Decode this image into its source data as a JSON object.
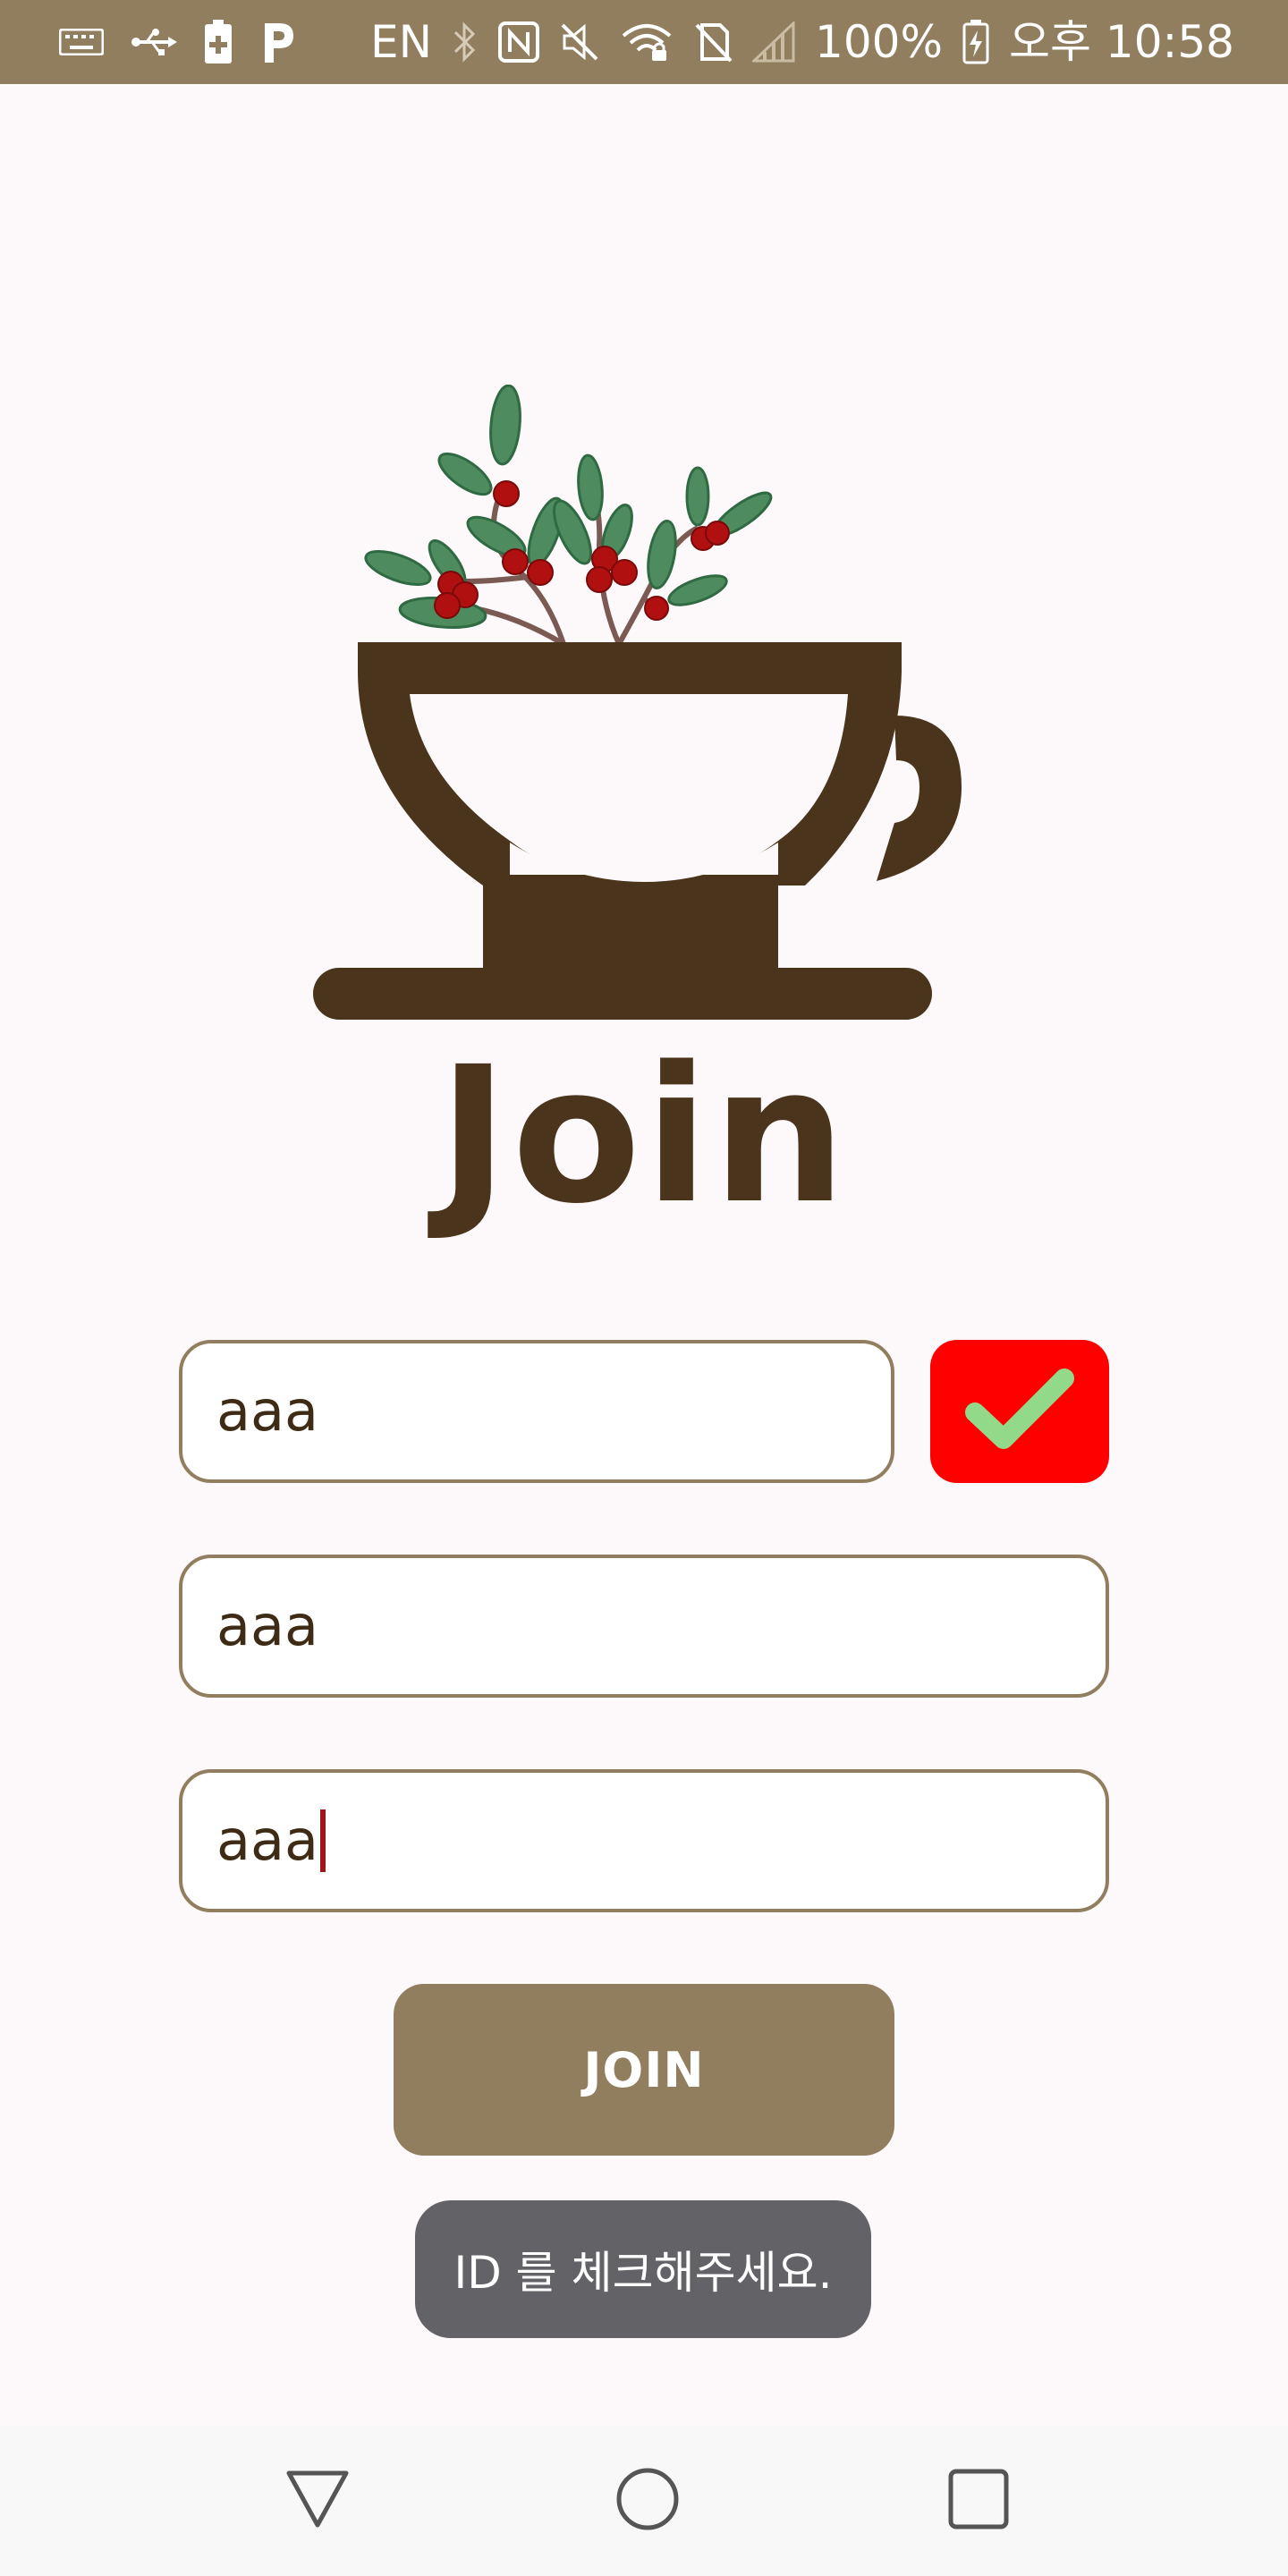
{
  "status_bar": {
    "language": "EN",
    "battery_percent": "100%",
    "time": "오후 10:58",
    "icons": [
      "keyboard-icon",
      "usb-icon",
      "battery-charging-icon",
      "parking-icon",
      "bluetooth-icon",
      "nfc-icon",
      "mute-icon",
      "wifi-icon",
      "no-sim-icon",
      "signal-icon",
      "battery-icon"
    ]
  },
  "page": {
    "title": "Join"
  },
  "form": {
    "id_field": {
      "value": "aaa"
    },
    "password_field": {
      "value": "aaa"
    },
    "password_confirm_field": {
      "value": "aaa"
    },
    "check_button_icon": "checkmark-icon",
    "join_label": "JOIN"
  },
  "toast": {
    "message": "ID 를 체크해주세요."
  },
  "nav_bar": {
    "icons": [
      "back-triangle-icon",
      "home-circle-icon",
      "recents-square-icon"
    ]
  },
  "colors": {
    "status_bar": "#917e5f",
    "accent_brown": "#4a341c",
    "button": "#917e5f",
    "check_button": "#ff0000",
    "check_mark": "#93d98a",
    "toast": "#636266"
  }
}
